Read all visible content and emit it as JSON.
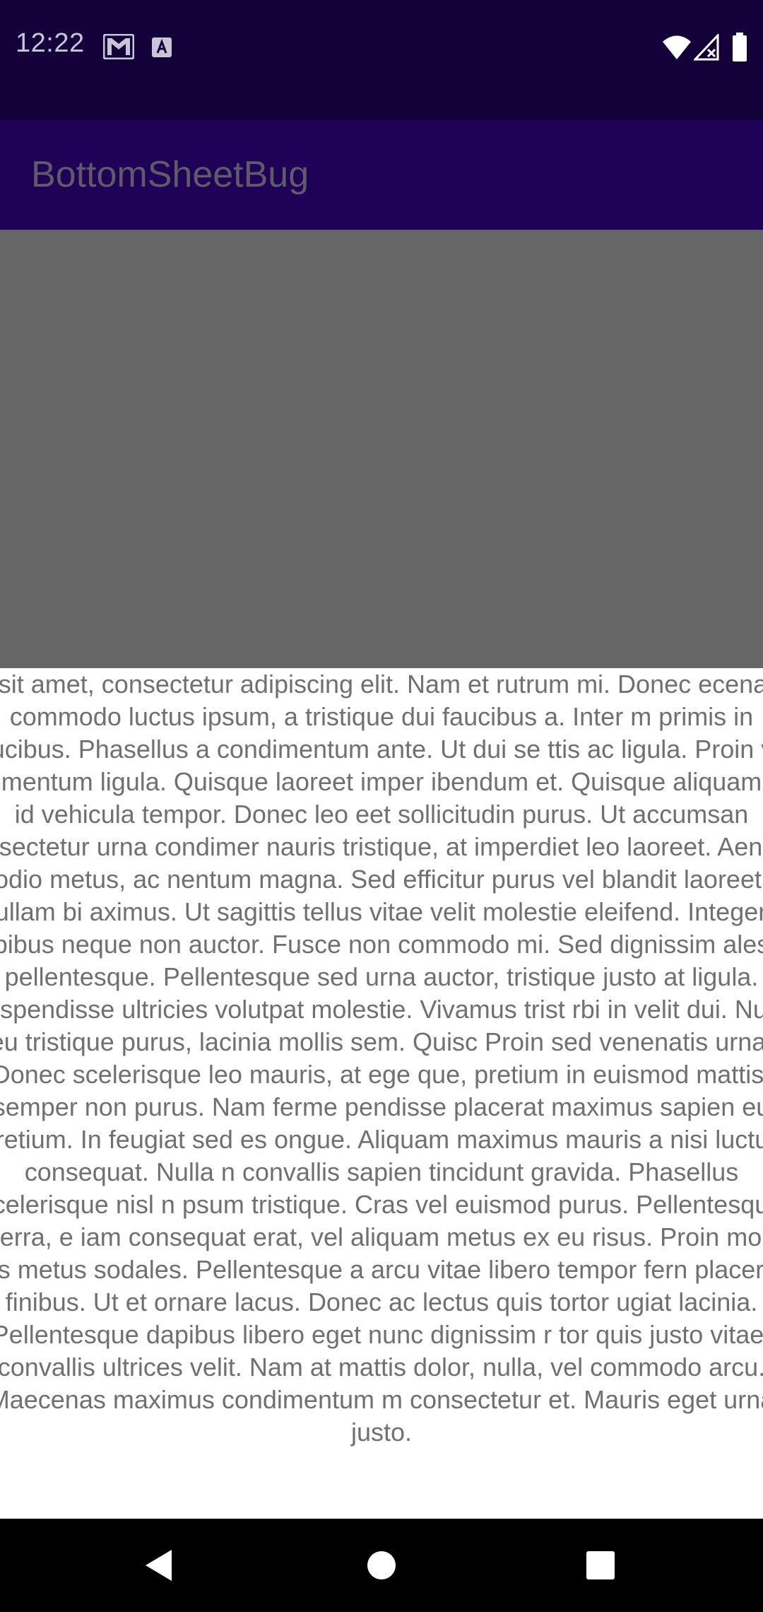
{
  "status_bar": {
    "time": "12:22",
    "left_icons": [
      "gmail-icon",
      "keyboard-a-icon"
    ],
    "right_icons": [
      "wifi-icon",
      "signal-no-service-icon",
      "battery-icon"
    ]
  },
  "app_bar": {
    "title": "BottomSheetBug",
    "background_color": "#1f0257"
  },
  "bottom_sheet": {
    "text": "r sit amet, consectetur adipiscing elit. Nam et rutrum mi. Donec ecenas commodo luctus ipsum, a tristique dui faucibus a. Inter m primis in faucibus. Phasellus a condimentum ante. Ut dui se ttis ac ligula. Proin vel elementum ligula. Quisque laoreet imper ibendum et. Quisque aliquam ex id vehicula tempor. Donec leo eet sollicitudin purus. Ut accumsan consectetur urna condimer nauris tristique, at imperdiet leo laoreet. Aenean odio metus, ac nentum magna. Sed efficitur purus vel blandit laoreet. Nullam bi aximus. Ut sagittis tellus vitae velit molestie eleifend. Integer s pibus neque non auctor. Fusce non commodo mi. Sed dignissim ales pellentesque. Pellentesque sed urna auctor, tristique justo at ligula. Suspendisse ultricies volutpat molestie. Vivamus trist rbi in velit dui. Nunc eu tristique purus, lacinia mollis sem. Quisc Proin sed venenatis urna. Donec scelerisque leo mauris, at ege que, pretium in euismod mattis, semper non purus. Nam ferme pendisse placerat maximus sapien eu pretium. In feugiat sed es ongue. Aliquam maximus mauris a nisi luctus consequat. Nulla n convallis sapien tincidunt gravida. Phasellus scelerisque nisl n psum tristique. Cras vel euismod purus. Pellentesque viverra, e iam consequat erat, vel aliquam metus ex eu risus. Proin moles ius metus sodales. Pellentesque a arcu vitae libero tempor fern placerat finibus. Ut et ornare lacus. Donec ac lectus quis tortor ugiat lacinia. Pellentesque dapibus libero eget nunc dignissim r tor quis justo vitae, convallis ultrices velit. Nam at mattis dolor, nulla, vel commodo arcu. Maecenas maximus condimentum m consectetur et. Mauris eget urna justo."
  },
  "nav_bar": {
    "back": "back-triangle-icon",
    "home": "home-circle-icon",
    "recents": "recents-square-icon"
  }
}
